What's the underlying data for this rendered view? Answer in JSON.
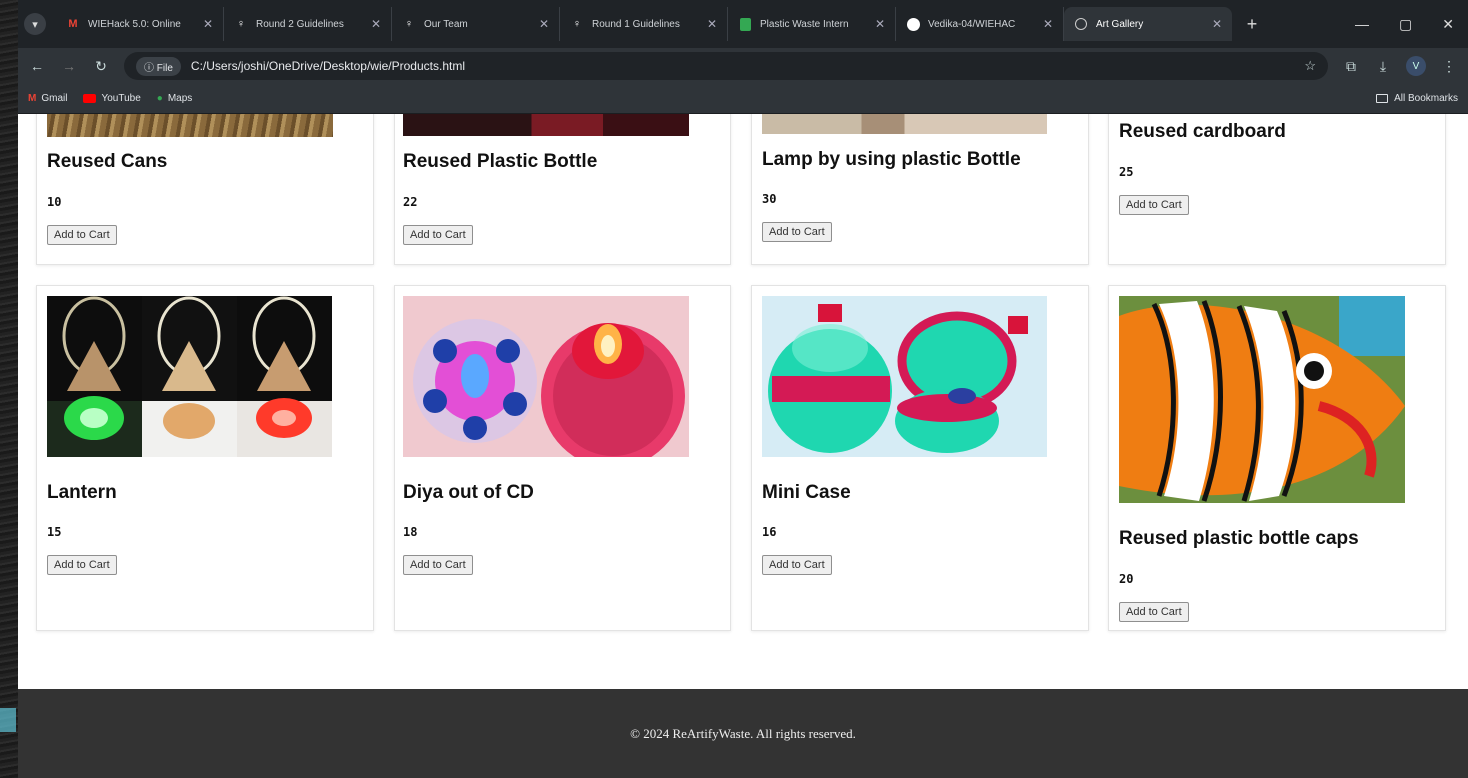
{
  "browser": {
    "tabs": [
      {
        "icon": "gmail-icon",
        "title": "WIEHack 5.0: Online"
      },
      {
        "icon": "devfolio-icon",
        "title": "Round 2 Guidelines"
      },
      {
        "icon": "devfolio-icon",
        "title": "Our Team"
      },
      {
        "icon": "devfolio-icon",
        "title": "Round 1 Guidelines"
      },
      {
        "icon": "sheet-icon",
        "title": "Plastic Waste Intern"
      },
      {
        "icon": "github-icon",
        "title": "Vedika-04/WIEHAC"
      },
      {
        "icon": "globe-icon",
        "title": "Art Gallery",
        "active": true
      }
    ],
    "address": {
      "chip": "File",
      "url": "C:/Users/joshi/OneDrive/Desktop/wie/Products.html"
    },
    "bookmarks": [
      {
        "icon": "gmail-icon",
        "label": "Gmail"
      },
      {
        "icon": "youtube-icon",
        "label": "YouTube"
      },
      {
        "icon": "maps-icon",
        "label": "Maps"
      }
    ],
    "all_bookmarks": "All Bookmarks",
    "profile_initial": "V"
  },
  "products": [
    {
      "name": "Reused Cans",
      "price": "10",
      "button": "Add to Cart"
    },
    {
      "name": "Reused Plastic Bottle",
      "price": "22",
      "button": "Add to Cart"
    },
    {
      "name": "Lamp by using plastic Bottle",
      "price": "30",
      "button": "Add to Cart"
    },
    {
      "name": "Reused cardboard",
      "price": "25",
      "button": "Add to Cart"
    },
    {
      "name": "Lantern",
      "price": "15",
      "button": "Add to Cart"
    },
    {
      "name": "Diya out of CD",
      "price": "18",
      "button": "Add to Cart"
    },
    {
      "name": "Mini Case",
      "price": "16",
      "button": "Add to Cart"
    },
    {
      "name": "Reused plastic bottle caps",
      "price": "20",
      "button": "Add to Cart"
    }
  ],
  "footer": {
    "text": "© 2024 ReArtifyWaste. All rights reserved."
  },
  "colors": {
    "footer_bg": "#333333",
    "chrome_bg": "#1f2327",
    "toolbar_bg": "#2f3439"
  }
}
